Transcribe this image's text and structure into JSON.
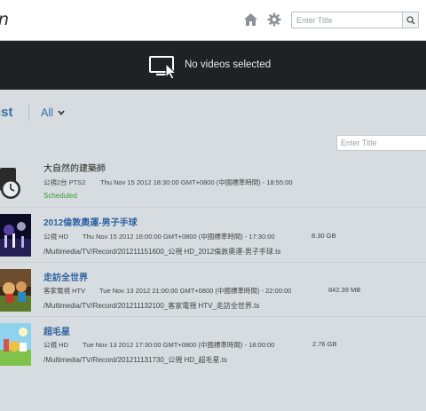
{
  "header": {
    "logo_fragment": "n",
    "search": {
      "placeholder": "Enter Title"
    }
  },
  "player": {
    "status_text": "No videos selected"
  },
  "list": {
    "title": "ist",
    "filter_value": "All",
    "search_placeholder": "Enter Title"
  },
  "recordings": [
    {
      "title": "大自然的建築師",
      "channel": "公視2台 PTS2",
      "time": "Thu Nov 15 2012 18:30:00 GMT+0800 (中國標準時間) - 18:55:00",
      "status": "Scheduled",
      "thumb_icon": "clock-icon"
    },
    {
      "title": "2012倫敦奧運-男子手球",
      "channel": "公視 HD",
      "time": "Thu Nov 15 2012 16:00:00 GMT+0800 (中國標準時間) - 17:30:00",
      "size": "8.30 GB",
      "path": "/Multimedia/TV/Record/201211151600_公視 HD_2012倫敦奧運-男子手球.ts"
    },
    {
      "title": "走訪全世界",
      "channel": "客家電視 HTV",
      "time": "Tue Nov 13 2012 21:00:00 GMT+0800 (中國標準時間) - 22:00:00",
      "size": "842.39 MB",
      "path": "/Multimedia/TV/Record/201211132100_客家電視 HTV_走訪全世界.ts"
    },
    {
      "title": "超毛星",
      "channel": "公視 HD",
      "time": "Tue Nov 13 2012 17:30:00 GMT+0800 (中國標準時間) - 18:00:00",
      "size": "2.76 GB",
      "path": "/Multimedia/TV/Record/201211131730_公視 HD_超毛星.ts"
    }
  ],
  "colors": {
    "accent": "#3a6ea5",
    "status_green": "#3d9a3a",
    "player_bg": "#1e2224",
    "page_bg": "#d6dcdf"
  }
}
